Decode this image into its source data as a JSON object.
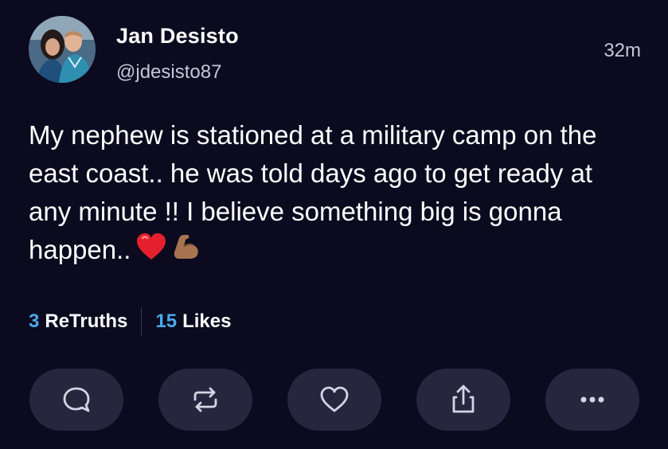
{
  "post": {
    "author": {
      "display_name": "Jan Desisto",
      "handle": "@jdesisto87",
      "avatar": "profile-photo"
    },
    "timestamp": "32m",
    "text": "My nephew is stationed at a military camp on the east coast.. he was told days ago to get ready at any minute !! I believe something big is gonna happen..",
    "emojis": [
      "red-heart",
      "flexed-biceps"
    ],
    "stats": {
      "retruths_count": "3",
      "retruths_label": "ReTruths",
      "likes_count": "15",
      "likes_label": "Likes"
    },
    "actions": [
      {
        "name": "reply",
        "icon": "speech-bubble-icon"
      },
      {
        "name": "retruth",
        "icon": "repost-arrows-icon"
      },
      {
        "name": "like",
        "icon": "heart-outline-icon"
      },
      {
        "name": "share",
        "icon": "share-upload-icon"
      },
      {
        "name": "more",
        "icon": "ellipsis-icon"
      }
    ]
  },
  "colors": {
    "background": "#0c0a1f",
    "button_bg": "#28263f",
    "accent_count": "#4aa8ea",
    "secondary_text": "#c8c6d6"
  }
}
